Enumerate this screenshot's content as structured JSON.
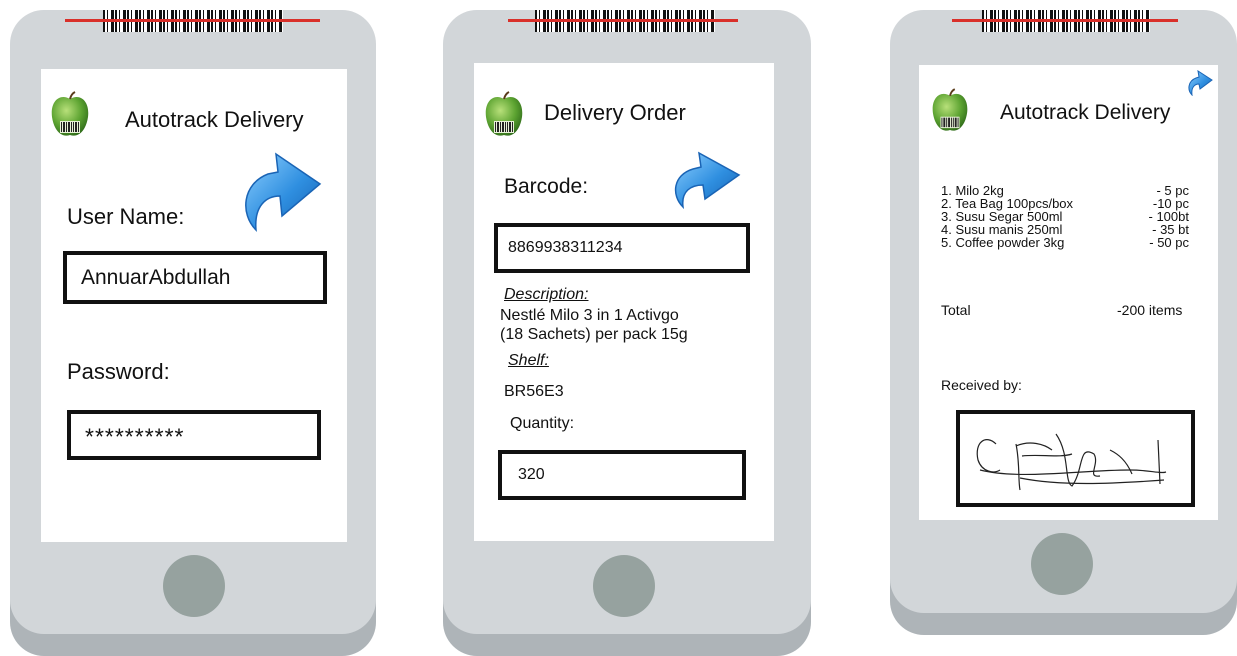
{
  "screens": [
    {
      "title": "Autotrack Delivery",
      "username_label": "User Name:",
      "username_value": "AnnuarAbdullah",
      "password_label": "Password:",
      "password_value": "**********"
    },
    {
      "title": "Delivery Order",
      "barcode_label": "Barcode:",
      "barcode_value": "8869938311234",
      "description_label": "Description:",
      "description_line1": "Nestlé Milo 3 in 1 Activgo",
      "description_line2": "(18 Sachets) per pack 15g",
      "shelf_label": "Shelf:",
      "shelf_value": "BR56E3",
      "quantity_label": "Quantity:",
      "quantity_value": "320"
    },
    {
      "title": "Autotrack Delivery",
      "items": [
        {
          "name": "1. Milo 2kg",
          "qty": "- 5  pc"
        },
        {
          "name": "2. Tea Bag 100pcs/box",
          "qty": "-10 pc"
        },
        {
          "name": "3. Susu Segar 500ml",
          "qty": "- 100bt"
        },
        {
          "name": "4. Susu manis 250ml",
          "qty": "- 35  bt"
        },
        {
          "name": "5. Coffee powder 3kg",
          "qty": "- 50 pc"
        }
      ],
      "total_label": "Total",
      "total_value": "-200 items",
      "received_label": "Received by:"
    }
  ],
  "icons": {
    "app_logo": "green-apple-barcode-icon",
    "next": "blue-curved-arrow-icon",
    "home": "home-button"
  },
  "colors": {
    "phone_body": "#d2d6d9",
    "phone_base": "#aeb4b8",
    "home_button": "#96a29f",
    "laser": "#d9302a",
    "arrow": "#2f8fe0"
  }
}
